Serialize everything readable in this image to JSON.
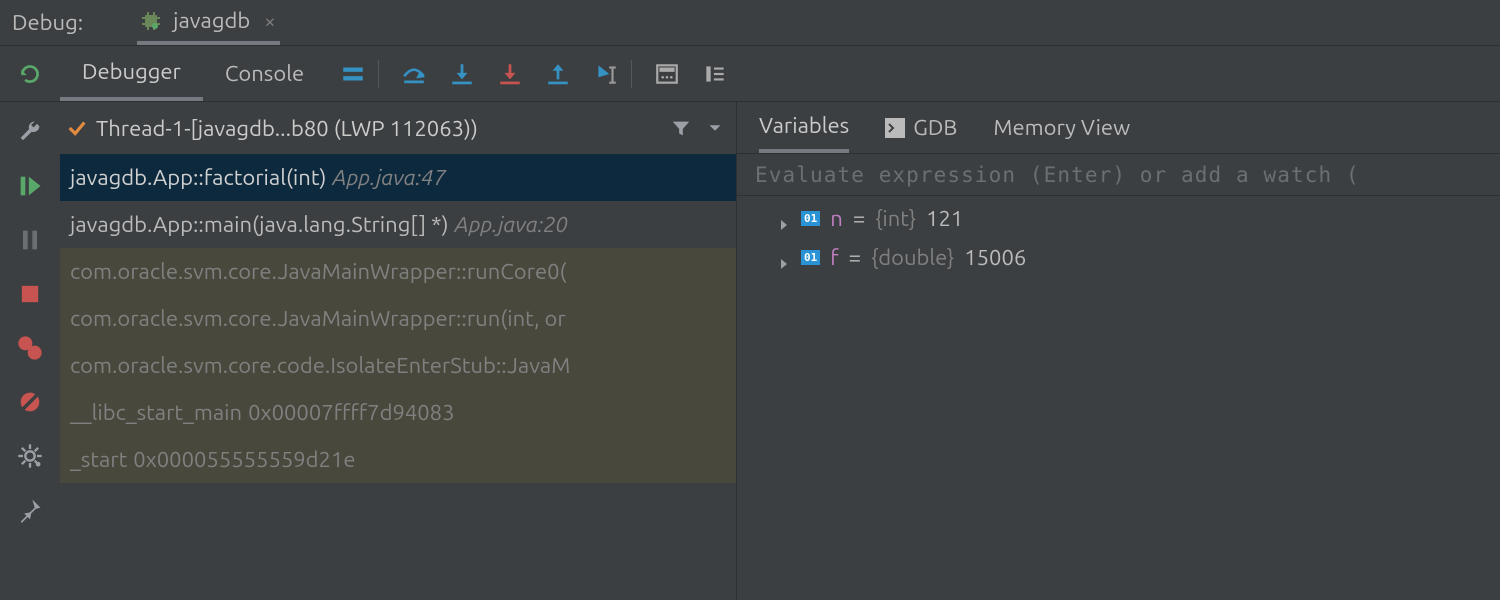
{
  "header": {
    "debug_label": "Debug:",
    "session_tab": "javagdb"
  },
  "toolbar": {
    "tabs": {
      "debugger": "Debugger",
      "console": "Console"
    }
  },
  "thread": {
    "title": "Thread-1-[javagdb...b80 (LWP 112063))"
  },
  "frames": [
    {
      "text": "javagdb.App::factorial(int)",
      "loc": "App.java:47",
      "loc_style": "italic",
      "state": "selected"
    },
    {
      "text": "javagdb.App::main(java.lang.String[] *)",
      "loc": "App.java:20",
      "loc_style": "italic",
      "state": "normal"
    },
    {
      "text": "com.oracle.svm.core.JavaMainWrapper::runCore0(",
      "loc": "",
      "loc_style": "",
      "state": "dimmed"
    },
    {
      "text": "com.oracle.svm.core.JavaMainWrapper::run(int, or",
      "loc": "",
      "loc_style": "",
      "state": "dimmed"
    },
    {
      "text": "com.oracle.svm.core.code.IsolateEnterStub::JavaM",
      "loc": "",
      "loc_style": "",
      "state": "dimmed"
    },
    {
      "text": "__libc_start_main",
      "loc": "0x00007ffff7d94083",
      "loc_style": "plain",
      "state": "dimmed"
    },
    {
      "text": "_start",
      "loc": "0x000055555559d21e",
      "loc_style": "plain",
      "state": "dimmed"
    }
  ],
  "vars_tabs": {
    "variables": "Variables",
    "gdb": "GDB",
    "memory": "Memory View"
  },
  "eval_placeholder": "Evaluate expression (Enter) or add a watch (",
  "variables": [
    {
      "badge": "01",
      "name": "n",
      "type": "{int}",
      "value": "121"
    },
    {
      "badge": "01",
      "name": "f",
      "type": "{double}",
      "value": "15006"
    }
  ]
}
